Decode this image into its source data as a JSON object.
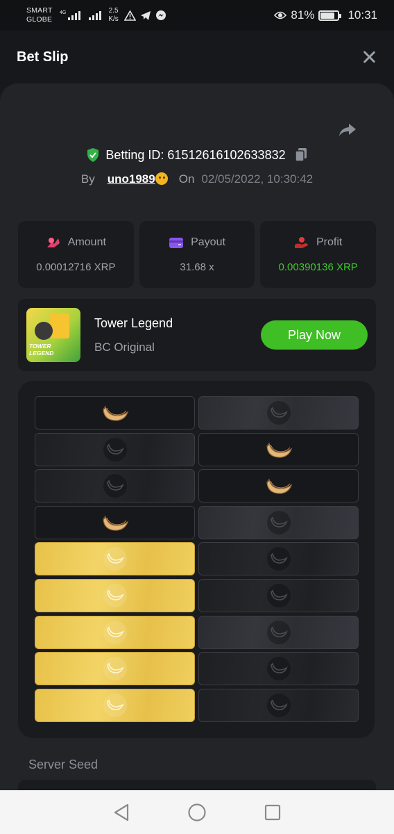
{
  "status_bar": {
    "carrier_line1": "SMART",
    "carrier_line2": "GLOBE",
    "network_type": "4G",
    "speed_value": "2.5",
    "speed_unit": "K/s",
    "battery_percent": "81%",
    "battery_level": 0.81,
    "time": "10:31"
  },
  "header": {
    "title": "Bet Slip"
  },
  "bet": {
    "id_label": "Betting ID: 615126161026338​32",
    "by_label": "By",
    "username": "uno1989",
    "on_label": "On",
    "datetime": "02/05/2022, 10:30:42"
  },
  "stats": {
    "amount_label": "Amount",
    "amount_value": "0.00012716 XRP",
    "payout_label": "Payout",
    "payout_value": "31.68 x",
    "profit_label": "Profit",
    "profit_value": "0.00390136 XRP",
    "profit_color": "#41c731"
  },
  "game": {
    "name": "Tower Legend",
    "category": "BC Original",
    "thumb_text_line1": "TOWER",
    "thumb_text_line2": "LEGEND",
    "play_label": "Play Now",
    "play_color": "#3fbe25"
  },
  "board": {
    "rows": [
      [
        "banana",
        "hidden"
      ],
      [
        "hidden-dark",
        "banana"
      ],
      [
        "hidden-dark",
        "banana"
      ],
      [
        "banana",
        "hidden"
      ],
      [
        "gold",
        "hidden-dark"
      ],
      [
        "gold",
        "hidden-dark"
      ],
      [
        "gold",
        "hidden"
      ],
      [
        "gold",
        "hidden-dark"
      ],
      [
        "gold",
        "hidden-dark"
      ]
    ]
  },
  "seed": {
    "server_seed_label": "Server Seed"
  },
  "icons": {
    "close": "close-icon",
    "share": "share-icon",
    "shield": "shield-check-icon",
    "copy": "copy-icon",
    "amount": "coins-icon",
    "payout": "wallet-icon",
    "profit": "hand-coin-icon",
    "back": "back-triangle-icon",
    "home": "home-circle-icon",
    "recents": "recents-square-icon"
  }
}
